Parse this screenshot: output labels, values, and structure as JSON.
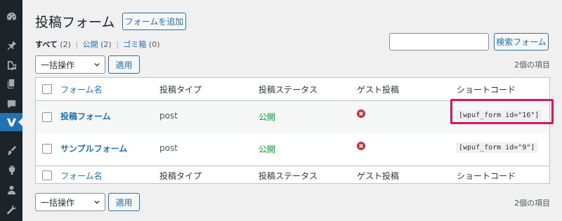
{
  "sidebar": {
    "items": [
      {
        "icon": "dashboard-icon"
      },
      {
        "icon": "pin-icon"
      },
      {
        "icon": "media-icon"
      },
      {
        "icon": "pages-icon"
      },
      {
        "icon": "comments-icon"
      },
      {
        "icon": "user-frontend-icon",
        "current": true
      },
      {
        "icon": "appearance-icon"
      },
      {
        "icon": "plugins-icon"
      },
      {
        "icon": "users-icon"
      },
      {
        "icon": "tools-icon"
      }
    ]
  },
  "header": {
    "title": "投稿フォーム",
    "add_new_label": "フォームを追加"
  },
  "views": {
    "all_label": "すべて",
    "all_count": "(2)",
    "publish_label": "公開",
    "publish_count": "(2)",
    "trash_label": "ゴミ箱",
    "trash_count": "(0)"
  },
  "search": {
    "value": "",
    "button_label": "検索フォーム"
  },
  "bulk": {
    "selected": "一括操作",
    "apply_label": "適用",
    "items_count": "2個の項目"
  },
  "table": {
    "columns": [
      "フォーム名",
      "投稿タイプ",
      "投稿ステータス",
      "ゲスト投稿",
      "ショートコード"
    ],
    "rows": [
      {
        "title": "投稿フォーム",
        "post_type": "post",
        "status": "公開",
        "guest": "no",
        "shortcode": "[wpuf_form id=\"16\"]"
      },
      {
        "title": "サンプルフォーム",
        "post_type": "post",
        "status": "公開",
        "guest": "no",
        "shortcode": "[wpuf_form id=\"9\"]"
      }
    ]
  },
  "colors": {
    "accent": "#2271b1",
    "sidebar_bg": "#1d2327",
    "status_published": "#00a32a",
    "guest_no": "#d63638",
    "highlight": "#e0115f"
  }
}
